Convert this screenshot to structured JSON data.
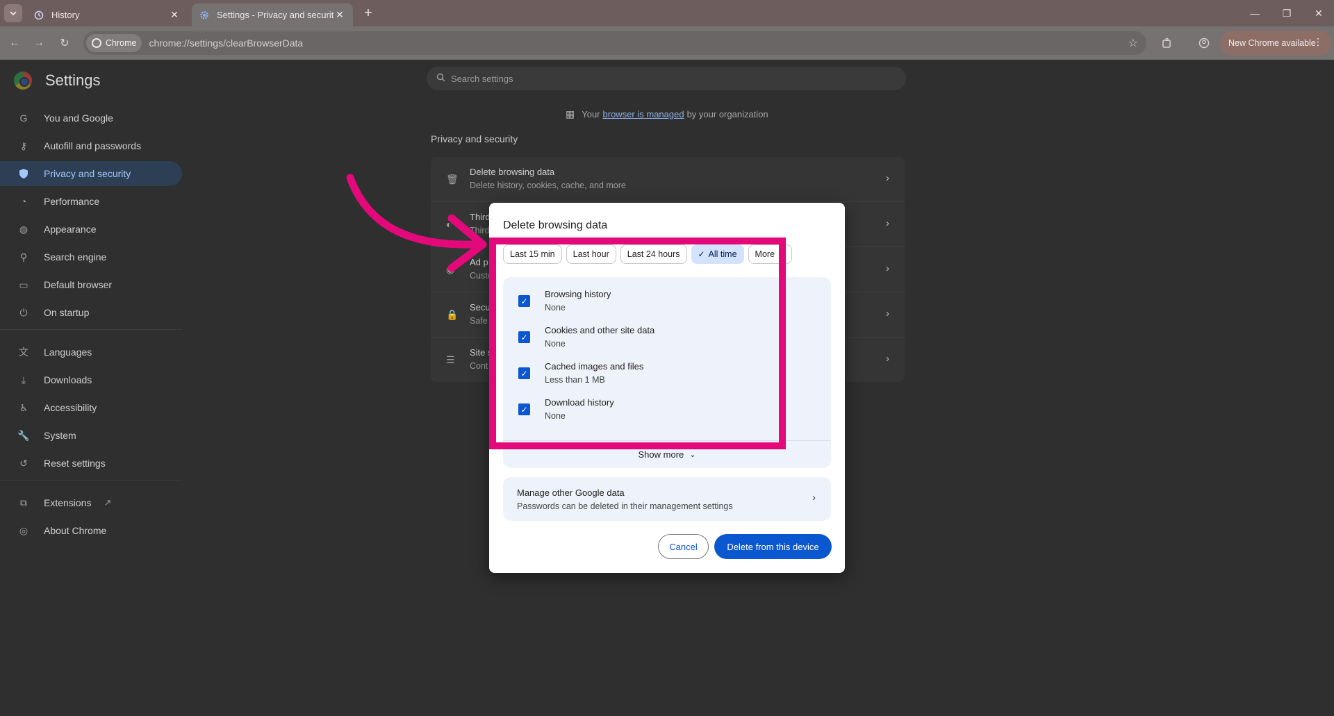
{
  "browser": {
    "tabs": [
      {
        "title": "History",
        "icon": "history-icon",
        "active": false
      },
      {
        "title": "Settings - Privacy and security",
        "icon": "gear-icon",
        "active": true
      }
    ],
    "new_tab": "+",
    "chip_label": "Chrome",
    "url": "chrome://settings/clearBrowserData",
    "update_label": "New Chrome available"
  },
  "settings": {
    "title": "Settings",
    "search_placeholder": "Search settings",
    "sidebar": [
      {
        "label": "You and Google",
        "icon": "google-icon"
      },
      {
        "label": "Autofill and passwords",
        "icon": "key-icon"
      },
      {
        "label": "Privacy and security",
        "icon": "shield-icon",
        "selected": true
      },
      {
        "label": "Performance",
        "icon": "speedometer-icon"
      },
      {
        "label": "Appearance",
        "icon": "palette-icon"
      },
      {
        "label": "Search engine",
        "icon": "search-icon"
      },
      {
        "label": "Default browser",
        "icon": "browser-icon"
      },
      {
        "label": "On startup",
        "icon": "power-icon"
      },
      {
        "label": "Languages",
        "icon": "translate-icon"
      },
      {
        "label": "Downloads",
        "icon": "download-icon"
      },
      {
        "label": "Accessibility",
        "icon": "accessibility-icon"
      },
      {
        "label": "System",
        "icon": "wrench-icon"
      },
      {
        "label": "Reset settings",
        "icon": "reset-icon"
      },
      {
        "label": "Extensions",
        "icon": "puzzle-icon"
      },
      {
        "label": "About Chrome",
        "icon": "chrome-icon"
      }
    ],
    "managed": {
      "prefix": "Your",
      "link": "browser is managed",
      "suffix": "by your organization"
    },
    "section_title": "Privacy and security",
    "rows": [
      {
        "title": "Delete browsing data",
        "subtitle": "Delete history, cookies, cache, and more",
        "icon": "trash-icon"
      },
      {
        "title": "Third",
        "subtitle": "Third",
        "icon": "cookie-icon"
      },
      {
        "title": "Ad p",
        "subtitle": "Custo",
        "icon": "ad-icon"
      },
      {
        "title": "Secu",
        "subtitle": "Safe",
        "icon": "lock-icon"
      },
      {
        "title": "Site s",
        "subtitle": "Cont",
        "icon": "sliders-icon"
      }
    ]
  },
  "dialog": {
    "title": "Delete browsing data",
    "time_ranges": [
      "Last 15 min",
      "Last hour",
      "Last 24 hours",
      "All time",
      "More"
    ],
    "selected_range": "All time",
    "options": [
      {
        "label": "Browsing history",
        "detail": "None",
        "checked": true
      },
      {
        "label": "Cookies and other site data",
        "detail": "None",
        "checked": true
      },
      {
        "label": "Cached images and files",
        "detail": "Less than 1 MB",
        "checked": true
      },
      {
        "label": "Download history",
        "detail": "None",
        "checked": true
      }
    ],
    "show_more": "Show more",
    "google": {
      "title": "Manage other Google data",
      "subtitle": "Passwords can be deleted in their management settings"
    },
    "cancel": "Cancel",
    "delete": "Delete from this device"
  },
  "colors": {
    "accent": "#0b57d0",
    "highlight": "#e4097a",
    "selected_chip": "#d3e3fd"
  }
}
